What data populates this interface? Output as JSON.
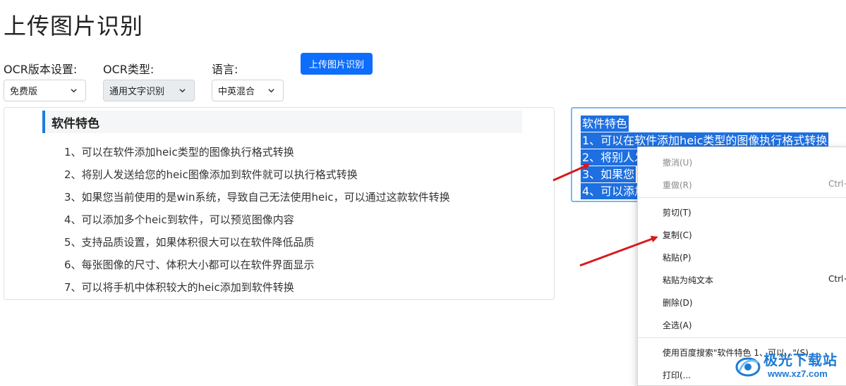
{
  "page": {
    "title": "上传图片识别"
  },
  "form": {
    "ocr_version": {
      "label": "OCR版本设置:",
      "value": "免费版"
    },
    "ocr_type": {
      "label": "OCR类型:",
      "value": "通用文字识别"
    },
    "language": {
      "label": "语言:",
      "value": "中英混合"
    },
    "upload_button": "上传图片识别"
  },
  "preview": {
    "heading": "软件特色",
    "lines": [
      "1、可以在软件添加heic类型的图像执行格式转换",
      "2、将别人发送给您的heic图像添加到软件就可以执行格式转换",
      "3、如果您当前使用的是win系统，导致自己无法使用heic，可以通过这款软件转换",
      "4、可以添加多个heic到软件，可以预览图像内容",
      "5、支持品质设置，如果体积很大可以在软件降低品质",
      "6、每张图像的尺寸、体积大小都可以在软件界面显示",
      "7、可以将手机中体积较大的heic添加到软件转换"
    ]
  },
  "result": {
    "lines": [
      "软件特色",
      "1、可以在软件添加heic类型的图像执行格式转换",
      "2、将别人发",
      "3、如果您",
      "4、可以添加"
    ]
  },
  "context_menu": {
    "undo": "撤消(U)",
    "redo": "重做(R)",
    "redo_shortcut": "Ctrl+",
    "cut": "剪切(T)",
    "copy": "复制(C)",
    "paste": "粘贴(P)",
    "paste_plain": "粘贴为纯文本",
    "paste_plain_shortcut": "Ctrl+",
    "delete": "删除(D)",
    "select_all": "全选(A)",
    "search": "使用百度搜索\"软件特色 1、可以...\"(S)",
    "print": "打印(..."
  },
  "watermark": {
    "name": "极光下载站",
    "url": "www.xz7.com"
  },
  "colors": {
    "primary": "#0d6efd",
    "selection": "#1e6fe0",
    "arrow": "#d9191c",
    "watermark": "#1f7ad4"
  }
}
